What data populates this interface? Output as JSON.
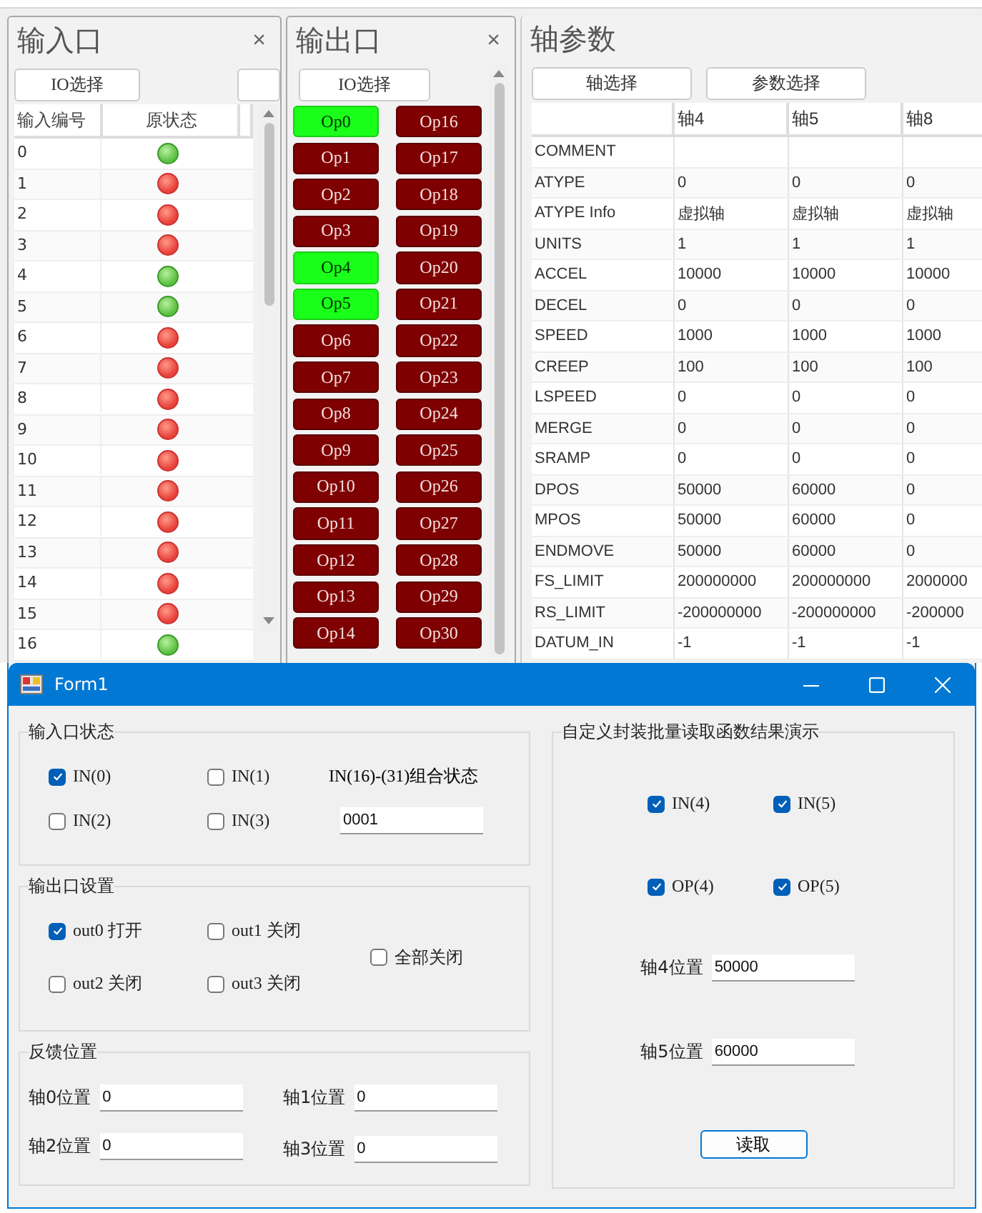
{
  "input_panel": {
    "title": "输入口",
    "close": "×",
    "io_button": "IO选择",
    "columns": [
      "输入编号",
      "原状态"
    ],
    "rows": [
      {
        "number": "0",
        "on": true
      },
      {
        "number": "1",
        "on": false
      },
      {
        "number": "2",
        "on": false
      },
      {
        "number": "3",
        "on": false
      },
      {
        "number": "4",
        "on": true
      },
      {
        "number": "5",
        "on": true
      },
      {
        "number": "6",
        "on": false
      },
      {
        "number": "7",
        "on": false
      },
      {
        "number": "8",
        "on": false
      },
      {
        "number": "9",
        "on": false
      },
      {
        "number": "10",
        "on": false
      },
      {
        "number": "11",
        "on": false
      },
      {
        "number": "12",
        "on": false
      },
      {
        "number": "13",
        "on": false
      },
      {
        "number": "14",
        "on": false
      },
      {
        "number": "15",
        "on": false
      },
      {
        "number": "16",
        "on": true
      }
    ]
  },
  "output_panel": {
    "title": "输出口",
    "close": "×",
    "io_button": "IO选择",
    "outputs": [
      {
        "label": "Op0",
        "on": true
      },
      {
        "label": "Op1",
        "on": false
      },
      {
        "label": "Op2",
        "on": false
      },
      {
        "label": "Op3",
        "on": false
      },
      {
        "label": "Op4",
        "on": true
      },
      {
        "label": "Op5",
        "on": true
      },
      {
        "label": "Op6",
        "on": false
      },
      {
        "label": "Op7",
        "on": false
      },
      {
        "label": "Op8",
        "on": false
      },
      {
        "label": "Op9",
        "on": false
      },
      {
        "label": "Op10",
        "on": false
      },
      {
        "label": "Op11",
        "on": false
      },
      {
        "label": "Op12",
        "on": false
      },
      {
        "label": "Op13",
        "on": false
      },
      {
        "label": "Op14",
        "on": false
      },
      {
        "label": "Op16",
        "on": false
      },
      {
        "label": "Op17",
        "on": false
      },
      {
        "label": "Op18",
        "on": false
      },
      {
        "label": "Op19",
        "on": false
      },
      {
        "label": "Op20",
        "on": false
      },
      {
        "label": "Op21",
        "on": false
      },
      {
        "label": "Op22",
        "on": false
      },
      {
        "label": "Op23",
        "on": false
      },
      {
        "label": "Op24",
        "on": false
      },
      {
        "label": "Op25",
        "on": false
      },
      {
        "label": "Op26",
        "on": false
      },
      {
        "label": "Op27",
        "on": false
      },
      {
        "label": "Op28",
        "on": false
      },
      {
        "label": "Op29",
        "on": false
      },
      {
        "label": "Op30",
        "on": false
      }
    ]
  },
  "axis_panel": {
    "title": "轴参数",
    "buttons": [
      "轴选择",
      "参数选择"
    ],
    "columns": [
      "轴4",
      "轴5",
      "轴8"
    ],
    "rows": [
      {
        "name": "COMMENT",
        "values": []
      },
      {
        "name": "ATYPE",
        "values": [
          "0",
          "0",
          "0"
        ]
      },
      {
        "name": "ATYPE Info",
        "values": [
          "虚拟轴",
          "虚拟轴",
          "虚拟轴"
        ]
      },
      {
        "name": "UNITS",
        "values": [
          "1",
          "1",
          "1"
        ]
      },
      {
        "name": "ACCEL",
        "values": [
          "10000",
          "10000",
          "10000"
        ]
      },
      {
        "name": "DECEL",
        "values": [
          "0",
          "0",
          "0"
        ]
      },
      {
        "name": "SPEED",
        "values": [
          "1000",
          "1000",
          "1000"
        ]
      },
      {
        "name": "CREEP",
        "values": [
          "100",
          "100",
          "100"
        ]
      },
      {
        "name": "LSPEED",
        "values": [
          "0",
          "0",
          "0"
        ]
      },
      {
        "name": "MERGE",
        "values": [
          "0",
          "0",
          "0"
        ]
      },
      {
        "name": "SRAMP",
        "values": [
          "0",
          "0",
          "0"
        ]
      },
      {
        "name": "DPOS",
        "values": [
          "50000",
          "60000",
          "0"
        ]
      },
      {
        "name": "MPOS",
        "values": [
          "50000",
          "60000",
          "0"
        ]
      },
      {
        "name": "ENDMOVE",
        "values": [
          "50000",
          "60000",
          "0"
        ]
      },
      {
        "name": "FS_LIMIT",
        "values": [
          "200000000",
          "200000000",
          "2000000"
        ]
      },
      {
        "name": "RS_LIMIT",
        "values": [
          "-200000000",
          "-200000000",
          "-200000"
        ]
      },
      {
        "name": "DATUM_IN",
        "values": [
          "-1",
          "-1",
          "-1"
        ]
      }
    ]
  },
  "form": {
    "title": "Form1",
    "input_group": {
      "title": "输入口状态",
      "checkboxes": [
        {
          "label": "IN(0)",
          "checked": true
        },
        {
          "label": "IN(1)",
          "checked": false
        },
        {
          "label": "IN(2)",
          "checked": false
        },
        {
          "label": "IN(3)",
          "checked": false
        }
      ],
      "combo_label": "IN(16)-(31)组合状态",
      "combo_value": "0001"
    },
    "output_group": {
      "title": "输出口设置",
      "checkboxes": [
        {
          "label": "out0 打开",
          "checked": true
        },
        {
          "label": "out1 关闭",
          "checked": false
        },
        {
          "label": "out2 关闭",
          "checked": false
        },
        {
          "label": "out3 关闭",
          "checked": false
        }
      ],
      "all_off": {
        "label": "全部关闭",
        "checked": false
      }
    },
    "feedback_group": {
      "title": "反馈位置",
      "fields": [
        {
          "label": "轴0位置",
          "value": "0"
        },
        {
          "label": "轴1位置",
          "value": "0"
        },
        {
          "label": "轴2位置",
          "value": "0"
        },
        {
          "label": "轴3位置",
          "value": "0"
        }
      ]
    },
    "demo_group": {
      "title": "自定义封装批量读取函数结果演示",
      "checkboxes": [
        {
          "label": "IN(4)",
          "checked": true
        },
        {
          "label": "IN(5)",
          "checked": true
        },
        {
          "label": "OP(4)",
          "checked": true
        },
        {
          "label": "OP(5)",
          "checked": true
        }
      ],
      "fields": [
        {
          "label": "轴4位置",
          "value": "50000"
        },
        {
          "label": "轴5位置",
          "value": "60000"
        }
      ],
      "read_button": "读取"
    }
  }
}
